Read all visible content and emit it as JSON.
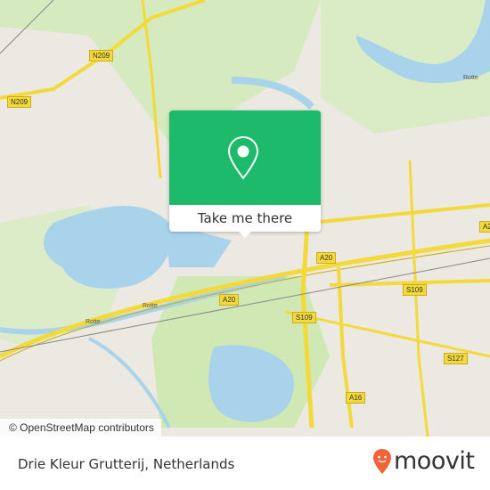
{
  "map": {
    "attribution": "© OpenStreetMap contributors",
    "road_labels": [
      "N209",
      "N209",
      "A20",
      "A20",
      "S109",
      "S109",
      "S127",
      "A16",
      "A2"
    ],
    "waterway_labels": [
      "Rotte",
      "Rotte",
      "Rotte"
    ],
    "colors": {
      "land": "#ece8e2",
      "water": "#a9d3ea",
      "park": "#cfe8b4",
      "road": "#f4d93b"
    }
  },
  "popup": {
    "button_label": "Take me there",
    "icon": "map-pin-icon",
    "color": "#1dba6b"
  },
  "footer": {
    "place_name": "Drie Kleur Grutterij, Netherlands",
    "brand": "moovit",
    "brand_color": "#f0643c"
  }
}
